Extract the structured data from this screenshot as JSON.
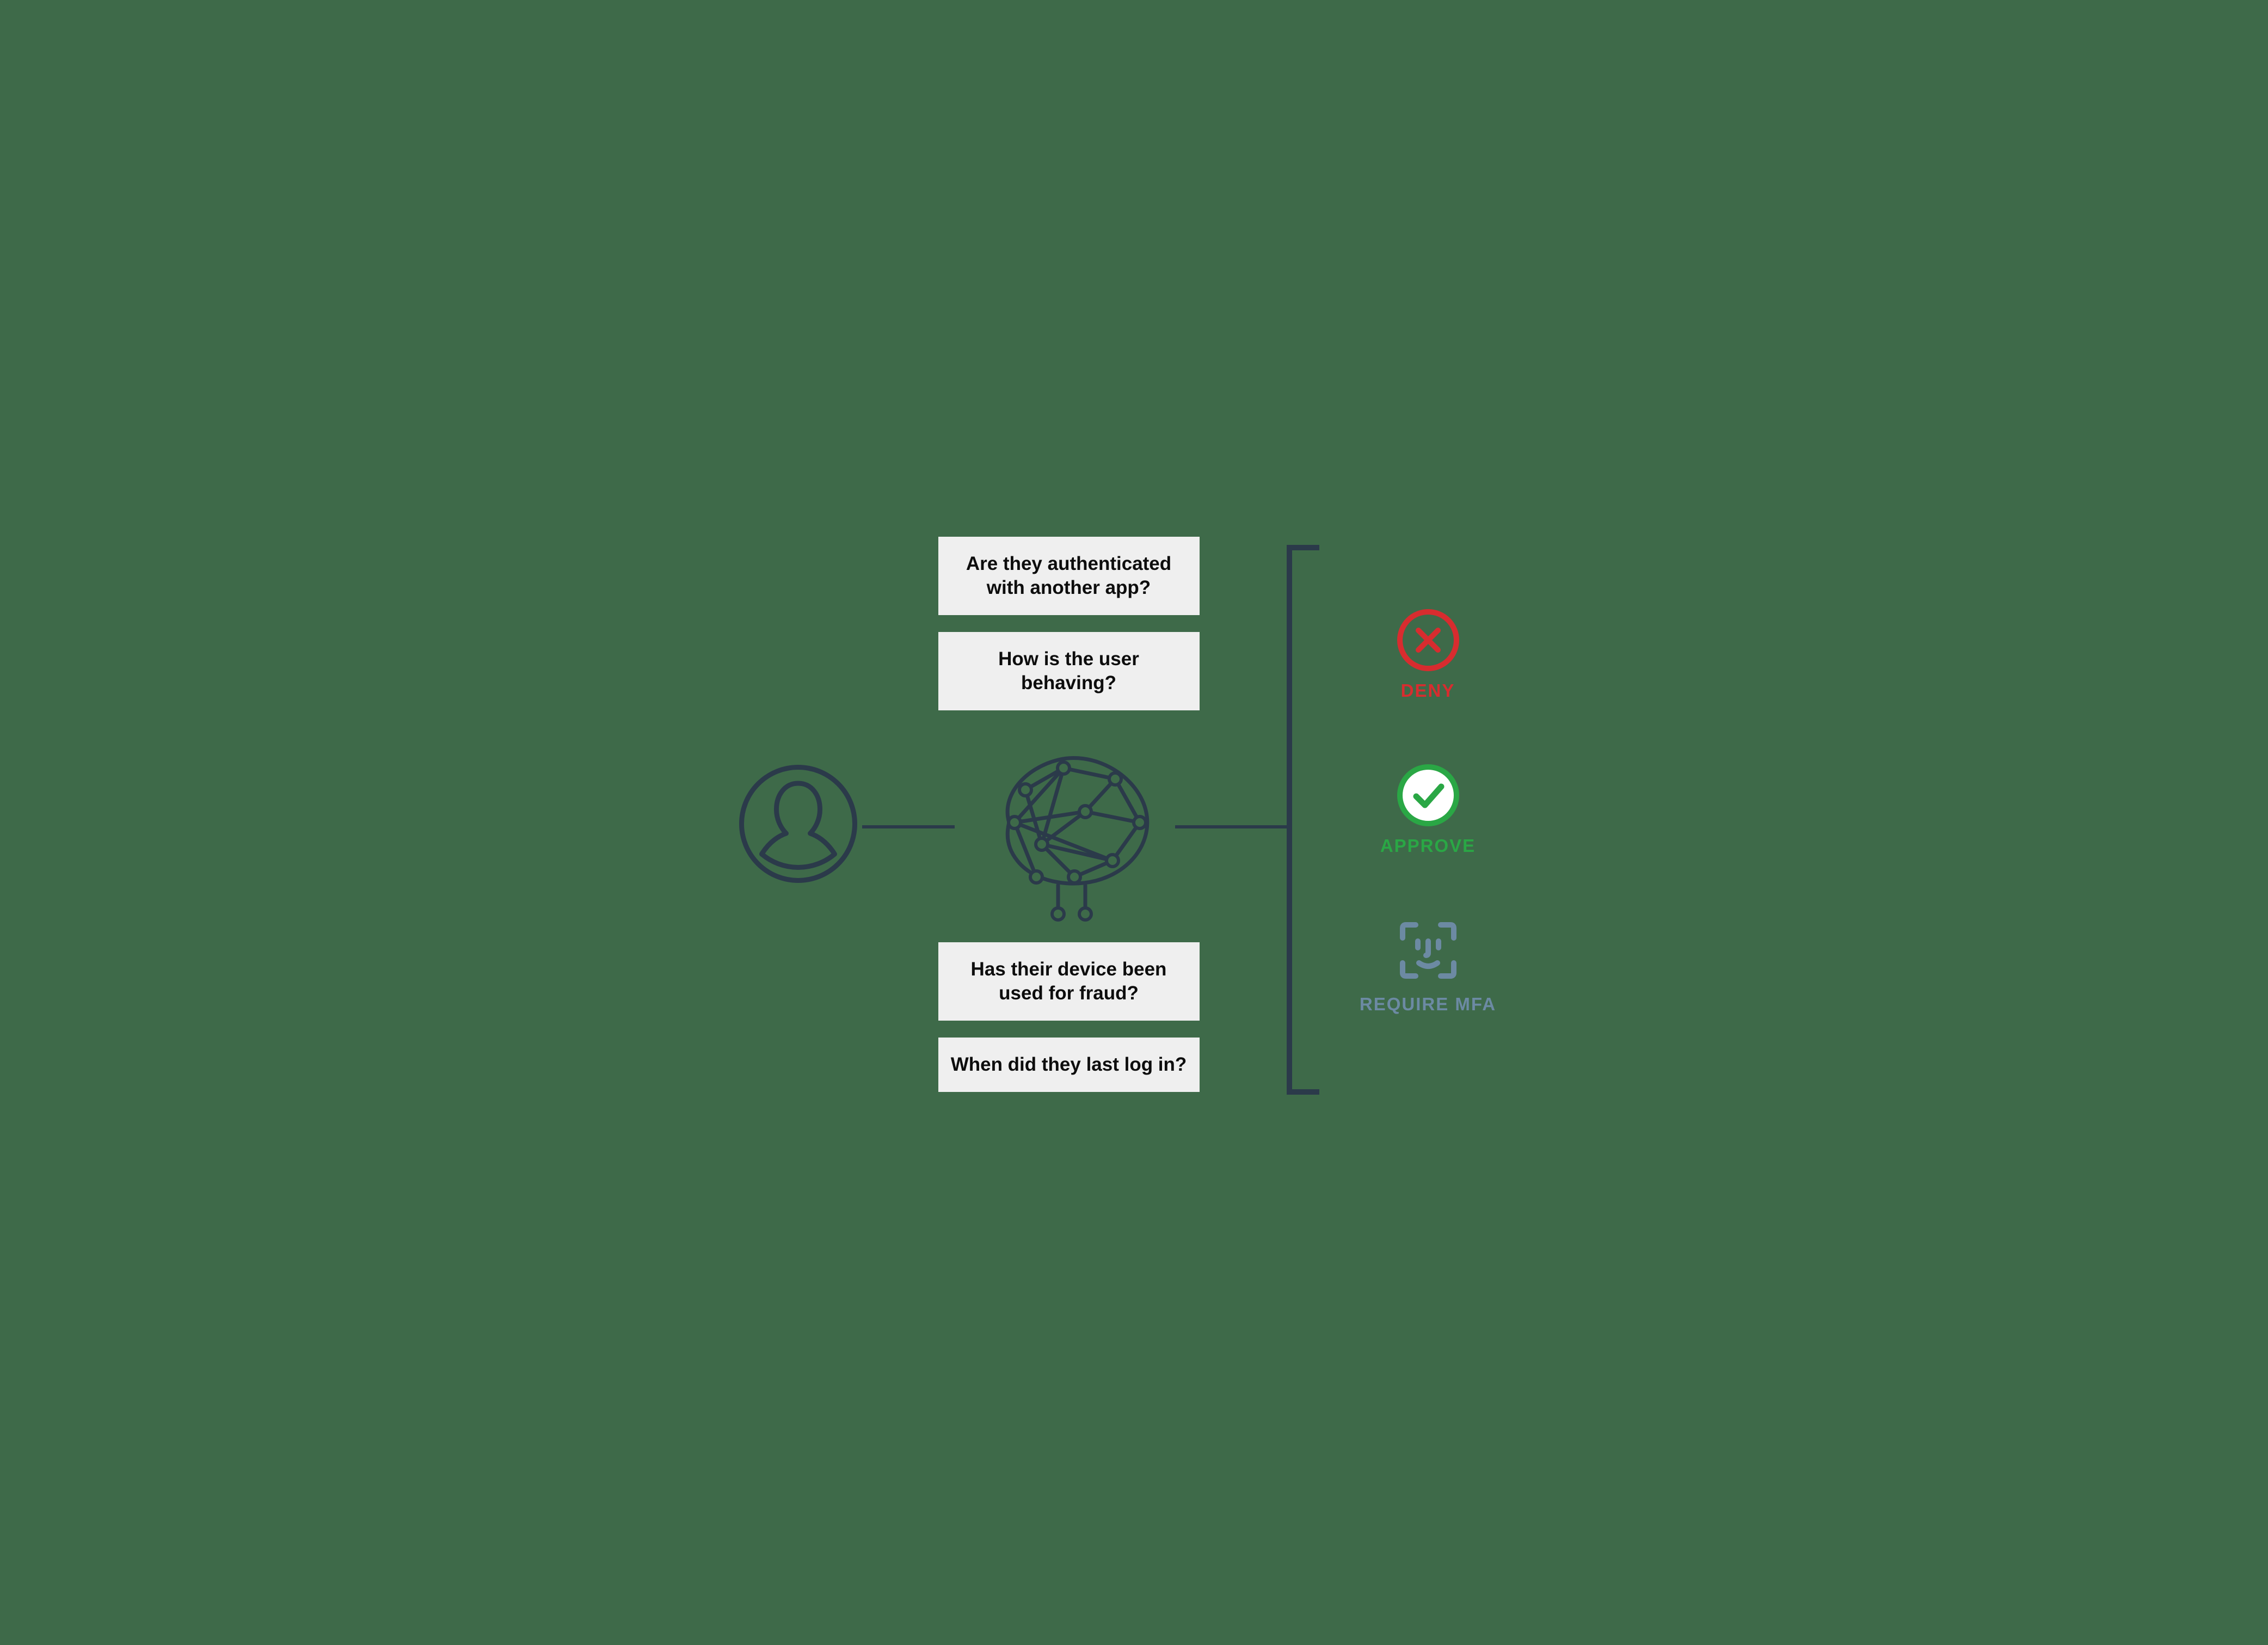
{
  "questions": {
    "q1": "Are they authenticated with another app?",
    "q2": "How is the user behaving?",
    "q3": "Has their device been used for fraud?",
    "q4": "When did they last log in?"
  },
  "outcomes": {
    "deny": "DENY",
    "approve": "APPROVE",
    "mfa": "REQUIRE MFA"
  },
  "colors": {
    "bg": "#3e6a49",
    "stroke": "#2b3a4a",
    "card_bg": "#efefef",
    "deny": "#d82c2f",
    "approve": "#2aa745",
    "mfa": "#6c8aa3"
  },
  "icons": {
    "user": "user-circle-icon",
    "brain": "neural-net-brain-icon",
    "deny": "x-circle-icon",
    "approve": "check-circle-filled-icon",
    "mfa": "face-id-icon"
  }
}
